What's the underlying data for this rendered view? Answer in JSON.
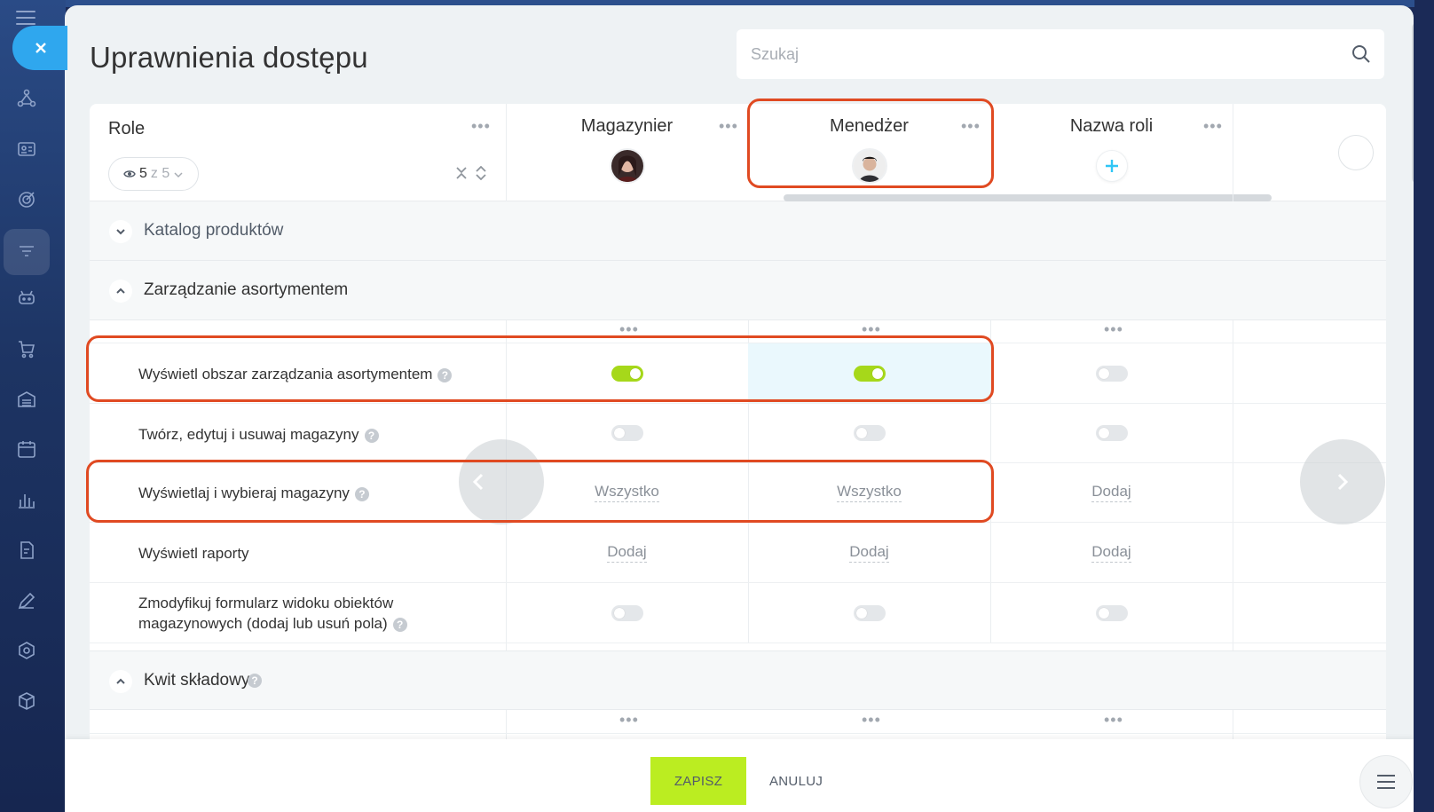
{
  "panel": {
    "title": "Uprawnienia dostępu",
    "search_placeholder": "Szukaj"
  },
  "roles_header": {
    "label": "Role",
    "visible_count": "5",
    "visible_of": "z 5"
  },
  "roles": [
    {
      "name": "Magazynier",
      "avatar": "avatar-woman"
    },
    {
      "name": "Menedżer",
      "avatar": "avatar-man"
    },
    {
      "name": "Nazwa roli",
      "avatar": "plus-icon"
    }
  ],
  "sections": {
    "catalog": {
      "title": "Katalog produktów",
      "expanded": false
    },
    "assortment": {
      "title": "Zarządzanie asortymentem",
      "expanded": true
    },
    "receipt": {
      "title": "Kwit składowy",
      "expanded": true
    }
  },
  "rows": [
    {
      "label": "Wyświetl obszar zarządzania asortymentem",
      "help": "?",
      "cells": [
        "on",
        "on",
        "off"
      ]
    },
    {
      "label": "Twórz, edytuj i usuwaj magazyny",
      "help": "?",
      "cells": [
        "off",
        "off",
        "off"
      ]
    },
    {
      "label": "Wyświetlaj i wybieraj magazyny",
      "help": "?",
      "cells": [
        "Wszystko",
        "Wszystko",
        "Dodaj"
      ]
    },
    {
      "label": "Wyświetl raporty",
      "help": "",
      "cells": [
        "Dodaj",
        "Dodaj",
        "Dodaj"
      ]
    },
    {
      "label_line1": "Zmodyfikuj formularz widoku obiektów",
      "label_line2": "magazynowych (dodaj lub usuń pola)",
      "help": "?",
      "cells": [
        "off",
        "off",
        "off"
      ]
    }
  ],
  "footer": {
    "save": "ZAPISZ",
    "cancel": "ANULUJ"
  },
  "colors": {
    "accent_blue": "#2fa7ee",
    "toggle_on": "#a6d81a",
    "save_button": "#bbed21",
    "highlight_frame": "#e04a22"
  }
}
